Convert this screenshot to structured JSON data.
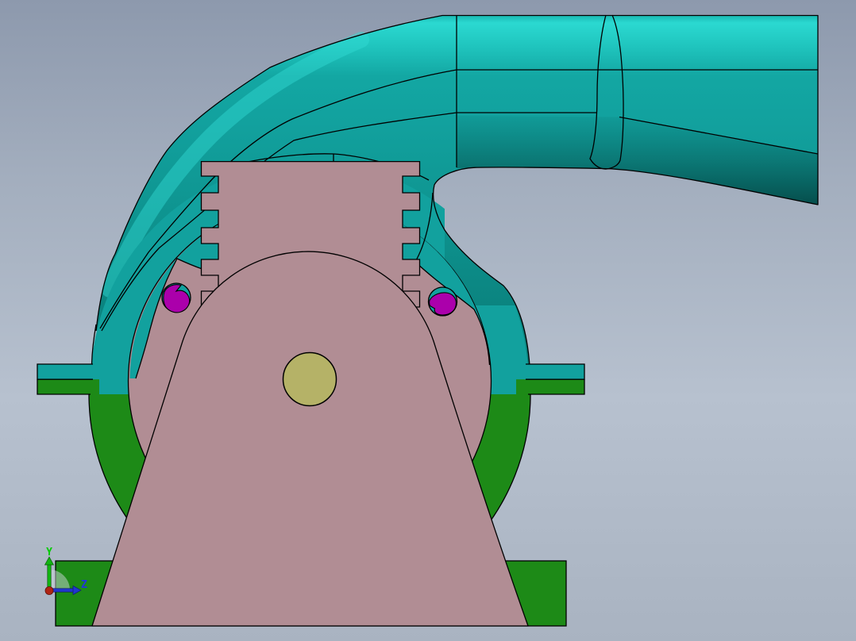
{
  "viewport": {
    "description": "3D CAD shaded viewport of a centrifugal pump volute assembly",
    "triad": {
      "y_label": "Y",
      "z_label": "Z"
    },
    "parts": [
      {
        "id": "discharge-pipe-elbow",
        "color_key": "pipe_teal"
      },
      {
        "id": "volute-front-casing",
        "color_key": "pipe_teal"
      },
      {
        "id": "volute-rear-casing",
        "color_key": "casing_green"
      },
      {
        "id": "split-flange-left",
        "color_key": "pipe_teal"
      },
      {
        "id": "split-flange-right",
        "color_key": "pipe_teal"
      },
      {
        "id": "ribbed-gland-block",
        "color_key": "cover_pink"
      },
      {
        "id": "front-cover-plate",
        "color_key": "cover_pink"
      },
      {
        "id": "bearing-pedestal",
        "color_key": "cover_pink"
      },
      {
        "id": "shaft-end",
        "color_key": "shaft_yellow"
      },
      {
        "id": "bolt-hole-left",
        "color_key": "bolt_magenta"
      },
      {
        "id": "bolt-hole-right",
        "color_key": "bolt_magenta"
      },
      {
        "id": "base-plate",
        "color_key": "casing_green"
      }
    ],
    "colors": {
      "background_top": "#8d99ad",
      "background_upper": "#a3aebe",
      "background_mid": "#b7c1cf",
      "background_bottom": "#a9b3c1",
      "pipe_teal": "#12a19e",
      "pipe_highlight": "#2bd9d1",
      "pipe_bright": "#34dcd4",
      "pipe_dark": "#097873",
      "casing_green": "#1d8a17",
      "cover_pink": "#b18d94",
      "shaft_yellow": "#b5b267",
      "bolt_magenta": "#ab00ab",
      "outline": "#000000",
      "triad_y": "#00cc00",
      "triad_z": "#2233dd",
      "triad_y_arrow": "#12b512",
      "triad_z_arrow": "#2136cf",
      "triad_origin": "#b02414"
    }
  }
}
